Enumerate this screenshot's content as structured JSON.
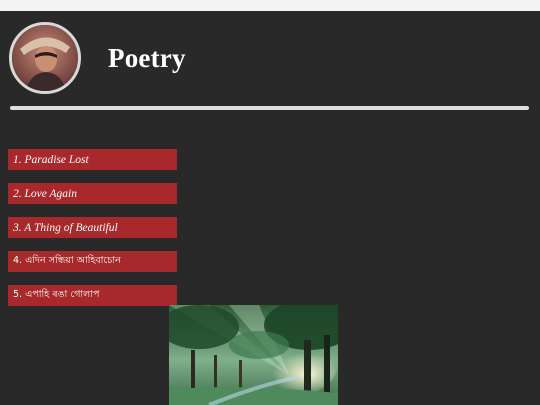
{
  "page": {
    "title": "Poetry"
  },
  "profile": {
    "avatar_icon": "user-photo-icon"
  },
  "poems": [
    {
      "label": "1. Paradise Lost"
    },
    {
      "label": "2. Love Again"
    },
    {
      "label": "3. A Thing of Beautiful"
    },
    {
      "label": "4. এদিন সন্ধিয়া আহিবাচোন"
    },
    {
      "label": "5. এপাহি ৰঙা গোলাপ"
    }
  ],
  "colors": {
    "background": "#292929",
    "button": "#a8292b",
    "divider": "#dedede"
  }
}
